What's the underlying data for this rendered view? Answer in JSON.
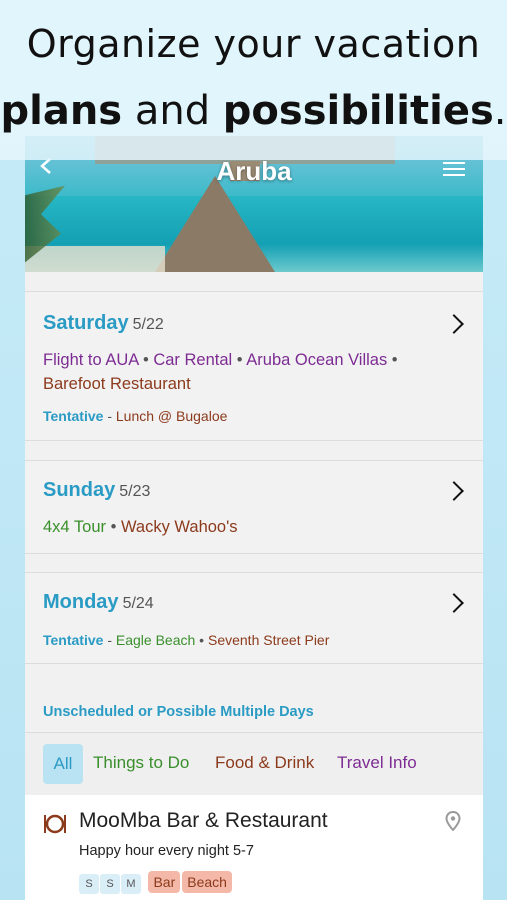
{
  "promo": {
    "line1": "Organize your vacation",
    "line2_bold1": "plans",
    "line2_mid": " and ",
    "line2_bold2": "possibilities",
    "line2_end": "."
  },
  "header": {
    "title": "Aruba",
    "back_icon": "chevron-left-icon",
    "menu_icon": "hamburger-menu-icon"
  },
  "days": [
    {
      "name": "Saturday",
      "date": "5/22",
      "items": [
        {
          "text": "Flight to AUA",
          "color": "#7d2c93"
        },
        {
          "text": "Car Rental",
          "color": "#7d2c93"
        },
        {
          "text": "Aruba Ocean Villas",
          "color": "#7d2c93"
        },
        {
          "text": "Barefoot Restaurant",
          "color": "#8c3a1c"
        }
      ],
      "tentative_label": "Tentative",
      "tentative": [
        {
          "text": "Lunch @ Bugaloe",
          "color": "#8c3a1c"
        }
      ]
    },
    {
      "name": "Sunday",
      "date": "5/23",
      "items": [
        {
          "text": "4x4 Tour",
          "color": "#3a8f2c"
        },
        {
          "text": "Wacky Wahoo's",
          "color": "#8c3a1c"
        }
      ]
    },
    {
      "name": "Monday",
      "date": "5/24",
      "tentative_label": "Tentative",
      "tentative": [
        {
          "text": "Eagle Beach",
          "color": "#3a8f2c"
        },
        {
          "text": "Seventh Street Pier",
          "color": "#8c3a1c"
        }
      ]
    }
  ],
  "unscheduled": {
    "label": "Unscheduled or Possible Multiple Days",
    "tabs": [
      {
        "label": "All",
        "active": true
      },
      {
        "label": "Things to Do",
        "color": "#3a8f2c"
      },
      {
        "label": "Food & Drink",
        "color": "#8c3a1c"
      },
      {
        "label": "Travel Info",
        "color": "#7d2c93"
      }
    ],
    "item": {
      "icon": "restaurant-icon",
      "title": "MooMba Bar & Restaurant",
      "description": "Happy hour every night 5-7",
      "days": [
        "S",
        "S",
        "M"
      ],
      "tags": [
        "Bar",
        "Beach"
      ],
      "pin_icon": "location-pin-icon"
    }
  },
  "colors": {
    "accent": "#2a9bc4",
    "travel": "#7d2c93",
    "food": "#8c3a1c",
    "activity": "#3a8f2c"
  }
}
